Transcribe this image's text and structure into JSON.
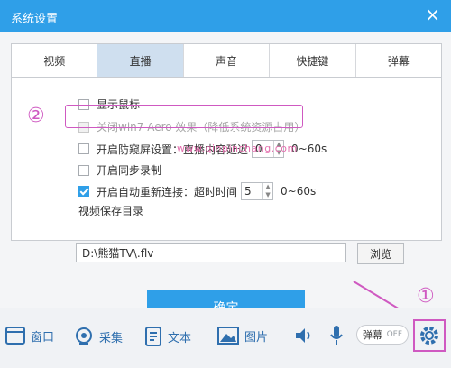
{
  "window": {
    "title": "系统设置",
    "close_glyph": "×"
  },
  "tabs": [
    {
      "label": "视频",
      "active": false
    },
    {
      "label": "直播",
      "active": true
    },
    {
      "label": "声音",
      "active": false
    },
    {
      "label": "快捷键",
      "active": false
    },
    {
      "label": "弹幕",
      "active": false
    }
  ],
  "options": {
    "show_cursor": {
      "label": "显示鼠标",
      "checked": false
    },
    "disable_aero": {
      "label": "关闭win7 Aero 效果（降低系统资源占用）",
      "checked": false,
      "disabled": true
    },
    "anti_peek": {
      "label": "开启防窥屏设置：直播内容延迟",
      "value": "0",
      "range": "0~60s",
      "checked": false
    },
    "sync_record": {
      "label": "开启同步录制",
      "checked": false
    },
    "auto_reconnect": {
      "label": "开启自动重新连接：超时时间",
      "value": "5",
      "range": "0~60s",
      "checked": true
    }
  },
  "save_dir": {
    "label": "视频保存目录",
    "path": "D:\\熊猫TV\\.flv",
    "browse_label": "浏览"
  },
  "confirm_label": "确定",
  "watermark": "www.qinpinchang.com",
  "annotations": {
    "circle_1": "①",
    "circle_2": "②"
  },
  "toolbar": {
    "items": [
      {
        "label": "窗口",
        "icon": "window-icon"
      },
      {
        "label": "采集",
        "icon": "camera-icon"
      },
      {
        "label": "文本",
        "icon": "text-icon"
      },
      {
        "label": "图片",
        "icon": "image-icon"
      }
    ],
    "danmaku_toggle": {
      "label": "弹幕",
      "state": "OFF"
    },
    "icons": [
      "speaker-icon",
      "microphone-icon",
      "gear-icon"
    ]
  },
  "colors": {
    "accent": "#2f9fe8",
    "annotation": "#cf59c1",
    "active_tab": "#cfdfef"
  }
}
